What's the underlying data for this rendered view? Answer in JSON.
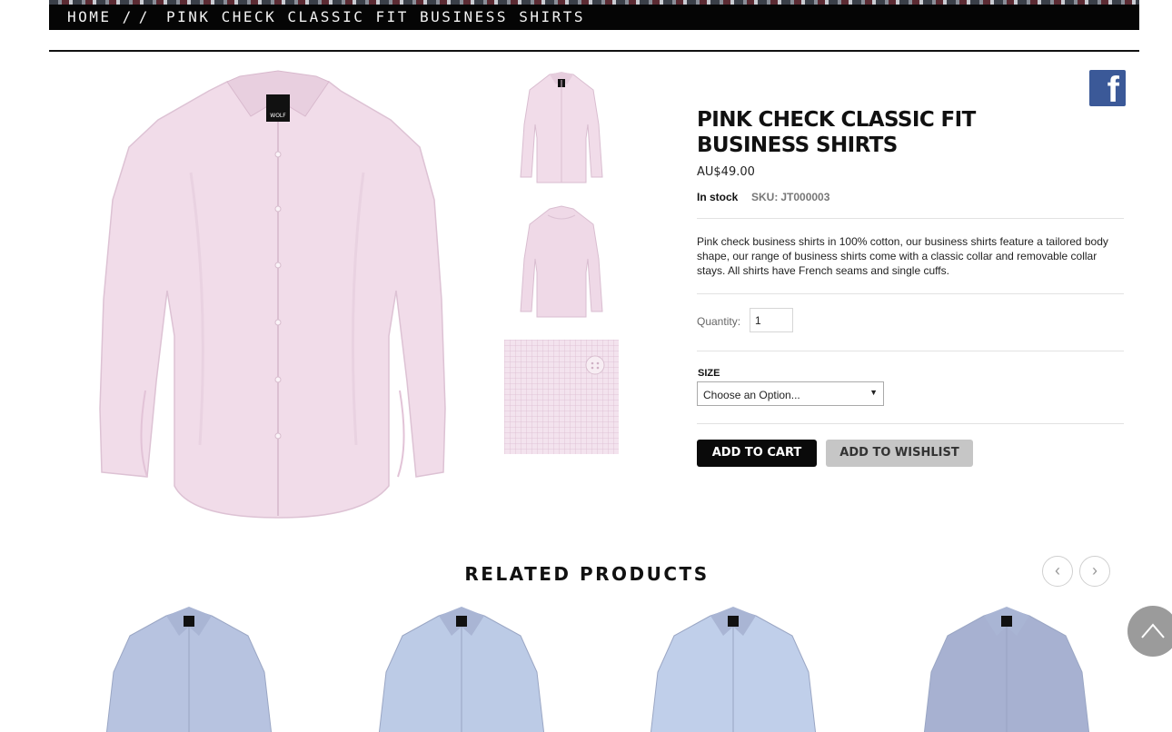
{
  "breadcrumb": {
    "home": "HOME /",
    "separator": "/",
    "current": "PINK CHECK CLASSIC FIT BUSINESS SHIRTS"
  },
  "product": {
    "title": "PINK CHECK CLASSIC FIT BUSINESS SHIRTS",
    "price": "AU$49.00",
    "stock": "In stock",
    "sku_label": "SKU:",
    "sku": "JT000003",
    "description": "Pink check business shirts in 100% cotton, our business shirts feature a tailored body shape, our range of business shirts come with a classic collar and removable collar stays. All shirts have French seams and single cuffs.",
    "quantity_label": "Quantity:",
    "quantity_value": "1",
    "size_label": "SIZE",
    "size_selected": "Choose an Option...",
    "add_to_cart": "ADD TO CART",
    "add_to_wishlist": "ADD TO WISHLIST",
    "label_text": "WOLF"
  },
  "related": {
    "title": "RELATED PRODUCTS",
    "prev_icon": "‹",
    "next_icon": "›",
    "items": [
      {
        "color": "#b7c3e0"
      },
      {
        "color": "#bccbe6"
      },
      {
        "color": "#c0cfea"
      },
      {
        "color": "#a7b1d1"
      }
    ]
  },
  "icons": {
    "facebook": "f",
    "scroll_top": "chevron-up-icon"
  },
  "colors": {
    "shirt_pink": "#f1dce9",
    "shirt_pink_shade": "#e2c3d7",
    "facebook_blue": "#3b5998"
  }
}
